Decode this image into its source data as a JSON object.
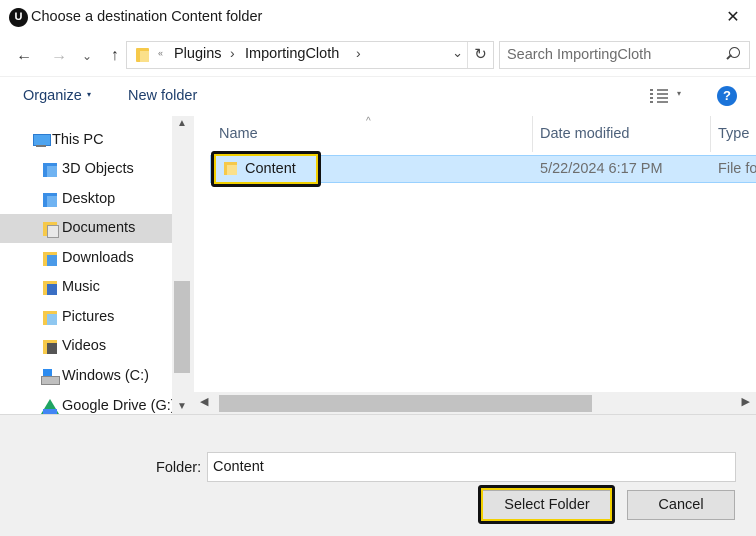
{
  "window": {
    "title": "Choose a destination Content folder",
    "app_icon_letter": "U",
    "close_glyph": "✕"
  },
  "nav": {
    "back_glyph": "←",
    "forward_glyph": "→",
    "recent_glyph": "⌄",
    "up_glyph": "↑"
  },
  "address": {
    "overflow_glyph": "«",
    "crumbs": [
      "Plugins",
      "ImportingCloth"
    ],
    "sep_glyph": "›",
    "dropdown_glyph": "⌄",
    "refresh_glyph": "↻"
  },
  "search": {
    "placeholder": "Search ImportingCloth",
    "icon": "search-icon"
  },
  "toolbar": {
    "organize_label": "Organize",
    "organize_caret": "▾",
    "new_folder_label": "New folder",
    "view_caret": "▾",
    "help_label": "?"
  },
  "sidebar": {
    "items": [
      {
        "label": "This PC",
        "icon": "computer-icon"
      },
      {
        "label": "3D Objects",
        "icon": "folder-3d-icon"
      },
      {
        "label": "Desktop",
        "icon": "desktop-folder-icon"
      },
      {
        "label": "Documents",
        "icon": "documents-folder-icon",
        "selected": true
      },
      {
        "label": "Downloads",
        "icon": "downloads-folder-icon"
      },
      {
        "label": "Music",
        "icon": "music-folder-icon"
      },
      {
        "label": "Pictures",
        "icon": "pictures-folder-icon"
      },
      {
        "label": "Videos",
        "icon": "videos-folder-icon"
      },
      {
        "label": "Windows (C:)",
        "icon": "drive-icon"
      },
      {
        "label": "Google Drive (G:)",
        "icon": "google-drive-icon"
      }
    ],
    "scroll_up_glyph": "▲",
    "scroll_down_glyph": "▼"
  },
  "file_list": {
    "columns": [
      "Name",
      "Date modified",
      "Type"
    ],
    "sort_glyph": "^",
    "rows": [
      {
        "name": "Content",
        "date": "5/22/2024 6:17 PM",
        "type": "File folder",
        "selected": true
      }
    ],
    "scroll_left_glyph": "◀",
    "scroll_right_glyph": "▶"
  },
  "footer": {
    "folder_label": "Folder:",
    "folder_value": "Content",
    "select_button": "Select Folder",
    "cancel_button": "Cancel"
  },
  "colors": {
    "selection_bg": "#cce8ff",
    "highlight_outline": "#f2d000",
    "accent_blue": "#1a73d9"
  }
}
